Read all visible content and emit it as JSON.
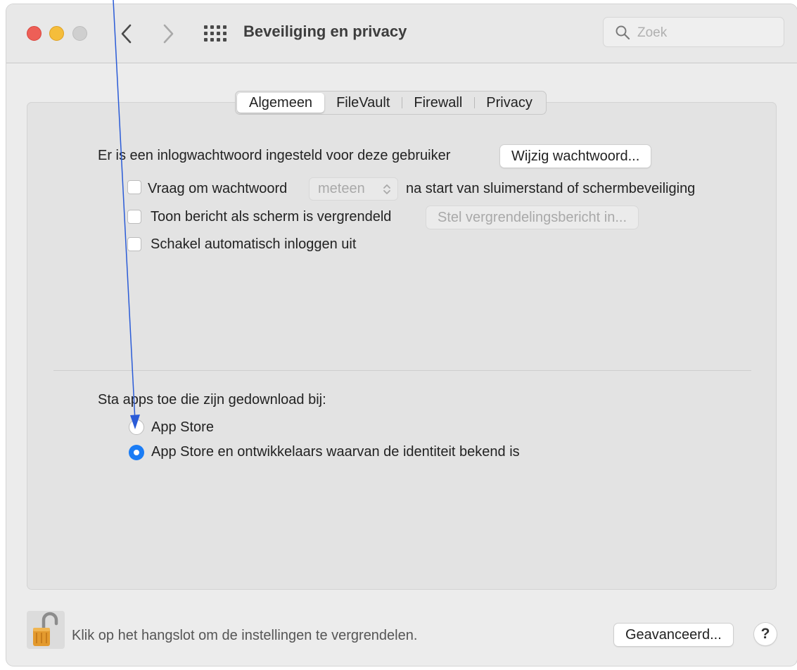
{
  "window": {
    "title": "Beveiliging en privacy"
  },
  "search": {
    "placeholder": "Zoek",
    "icon": "magnifier-icon"
  },
  "tabs": [
    {
      "label": "Algemeen",
      "selected": true
    },
    {
      "label": "FileVault",
      "selected": false
    },
    {
      "label": "Firewall",
      "selected": false
    },
    {
      "label": "Privacy",
      "selected": false
    }
  ],
  "general": {
    "password_text": "Er is een inlogwachtwoord ingesteld voor deze gebruiker",
    "change_password_button": "Wijzig wachtwoord...",
    "ask_password": {
      "label": "Vraag om wachtwoord",
      "popup_value": "meteen",
      "suffix": "na start van sluimerstand of schermbeveiliging",
      "checked": false
    },
    "show_message": {
      "label": "Toon bericht als scherm is vergrendeld",
      "button": "Stel vergrendelingsbericht in...",
      "checked": false
    },
    "disable_autologin": {
      "label": "Schakel automatisch inloggen uit",
      "checked": false
    }
  },
  "apps": {
    "heading": "Sta apps toe die zijn gedownload bij:",
    "options": [
      {
        "label": "App Store",
        "selected": false
      },
      {
        "label": "App Store en ontwikkelaars waarvan de identiteit bekend is",
        "selected": true
      }
    ]
  },
  "footer": {
    "lock_text": "Klik op het hangslot om de instellingen te vergrendelen.",
    "advanced_button": "Geavanceerd...",
    "help_label": "?"
  },
  "colors": {
    "close": "#ed5f57",
    "minimize": "#f5bd3b",
    "accent": "#1a7cf5",
    "annotation": "#2a5bd7"
  }
}
